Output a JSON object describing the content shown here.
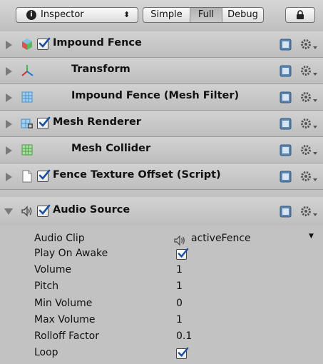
{
  "toolbar": {
    "inspector_label": "Inspector",
    "inspector_arrows": "⬍",
    "info_glyph": "i",
    "mode_tabs": [
      "Simple",
      "Full",
      "Debug"
    ],
    "selected_mode": "Full"
  },
  "components": [
    {
      "name": "Impound Fence",
      "icon": "gameobject-cube-icon",
      "has_checkbox": true,
      "checked": true,
      "expanded": false
    },
    {
      "name": "Transform",
      "icon": "transform-axes-icon",
      "has_checkbox": false,
      "expanded": false
    },
    {
      "name": "Impound Fence (Mesh Filter)",
      "icon": "mesh-filter-icon",
      "has_checkbox": false,
      "expanded": false
    },
    {
      "name": "Mesh Renderer",
      "icon": "mesh-renderer-icon",
      "has_checkbox": true,
      "checked": true,
      "expanded": false
    },
    {
      "name": "Mesh Collider",
      "icon": "mesh-collider-icon",
      "has_checkbox": false,
      "expanded": false
    },
    {
      "name": "Fence Texture Offset (Script)",
      "icon": "script-document-icon",
      "has_checkbox": true,
      "checked": true,
      "expanded": false
    },
    {
      "name": "Audio Source",
      "icon": "speaker-icon",
      "has_checkbox": true,
      "checked": true,
      "expanded": true
    }
  ],
  "audio_source": {
    "properties": [
      {
        "label": "Audio Clip",
        "value": "activeFence",
        "type": "object-field"
      },
      {
        "label": "Play On Awake",
        "value": true,
        "type": "checkbox"
      },
      {
        "label": "Volume",
        "value": "1",
        "type": "number"
      },
      {
        "label": "Pitch",
        "value": "1",
        "type": "number"
      },
      {
        "label": "Min Volume",
        "value": "0",
        "type": "number"
      },
      {
        "label": "Max Volume",
        "value": "1",
        "type": "number"
      },
      {
        "label": "Rolloff Factor",
        "value": "0.1",
        "type": "number"
      },
      {
        "label": "Loop",
        "value": true,
        "type": "checkbox"
      }
    ],
    "clip_dropdown_arrow": "▼"
  },
  "colors": {
    "row_bg": "#c8c8c8",
    "panel_bg": "#c2c2c2",
    "help_icon_blue": "#5b86b3",
    "check_blue": "#1a4fa0"
  }
}
